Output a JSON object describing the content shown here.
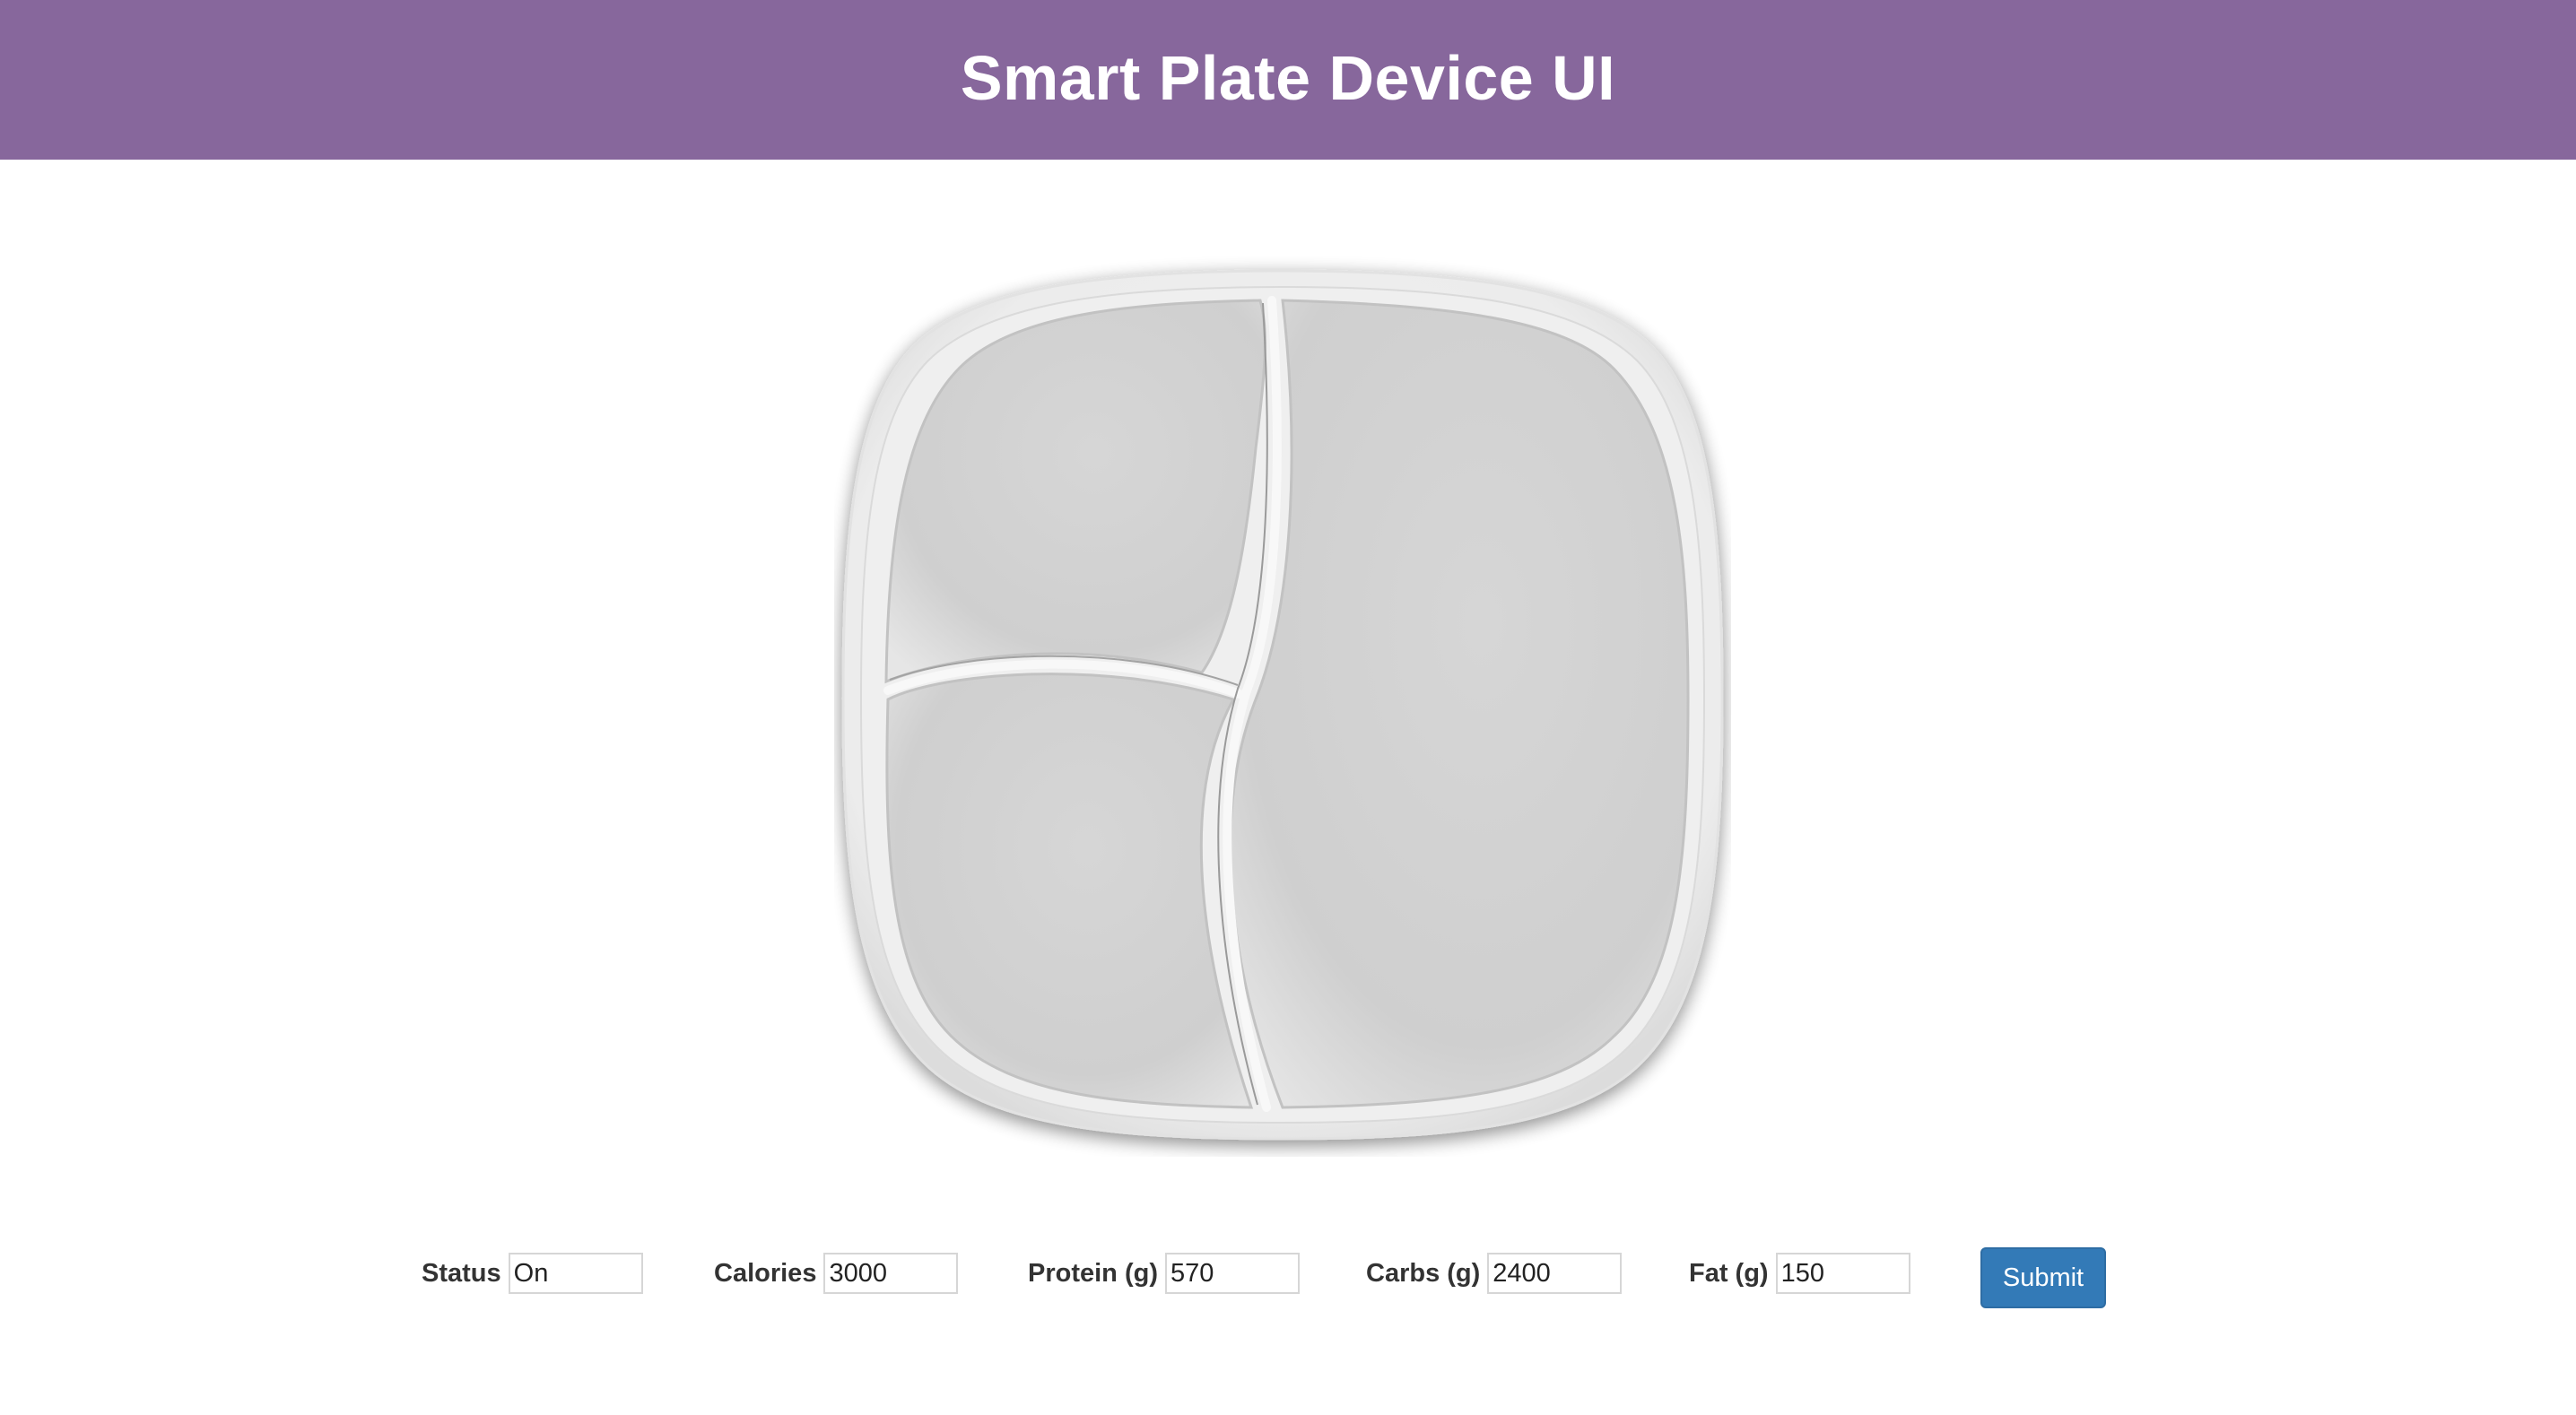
{
  "header": {
    "title": "Smart Plate Device UI"
  },
  "plate": {
    "icon": "divided-plate-image",
    "compartments": 3
  },
  "form": {
    "fields": [
      {
        "label": "Status",
        "value": "On"
      },
      {
        "label": "Calories",
        "value": "3000"
      },
      {
        "label": "Protein (g)",
        "value": "570"
      },
      {
        "label": "Carbs (g)",
        "value": "2400"
      },
      {
        "label": "Fat (g)",
        "value": "150"
      }
    ],
    "submit_label": "Submit"
  },
  "colors": {
    "header_bg": "#87679c",
    "header_text": "#ffffff",
    "button_bg": "#337ab7",
    "plate": "#d4d4d4"
  }
}
